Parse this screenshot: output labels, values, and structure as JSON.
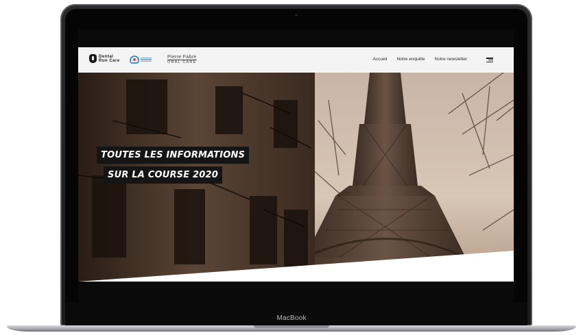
{
  "device": {
    "brand_label": "MacBook"
  },
  "header": {
    "logo_dental_line1": "Dental",
    "logo_dental_line2": "Run Care",
    "logo_pf_line1": "Pierre Fabre",
    "logo_pf_line2": "ORAL CARE",
    "nav": [
      {
        "label": "Accueil",
        "icon": ""
      },
      {
        "label": "Notre enquête",
        "icon": ""
      },
      {
        "label": "Notre newsletter",
        "icon": ""
      }
    ],
    "menu_icon": "hamburger-menu-icon"
  },
  "hero": {
    "title_line1": "TOUTES LES INFORMATIONS",
    "title_line2": "SUR LA COURSE 2020"
  },
  "colors": {
    "header_bg": "#f4f4f4",
    "title_bg": "#151515",
    "title_text": "#ffffff"
  }
}
